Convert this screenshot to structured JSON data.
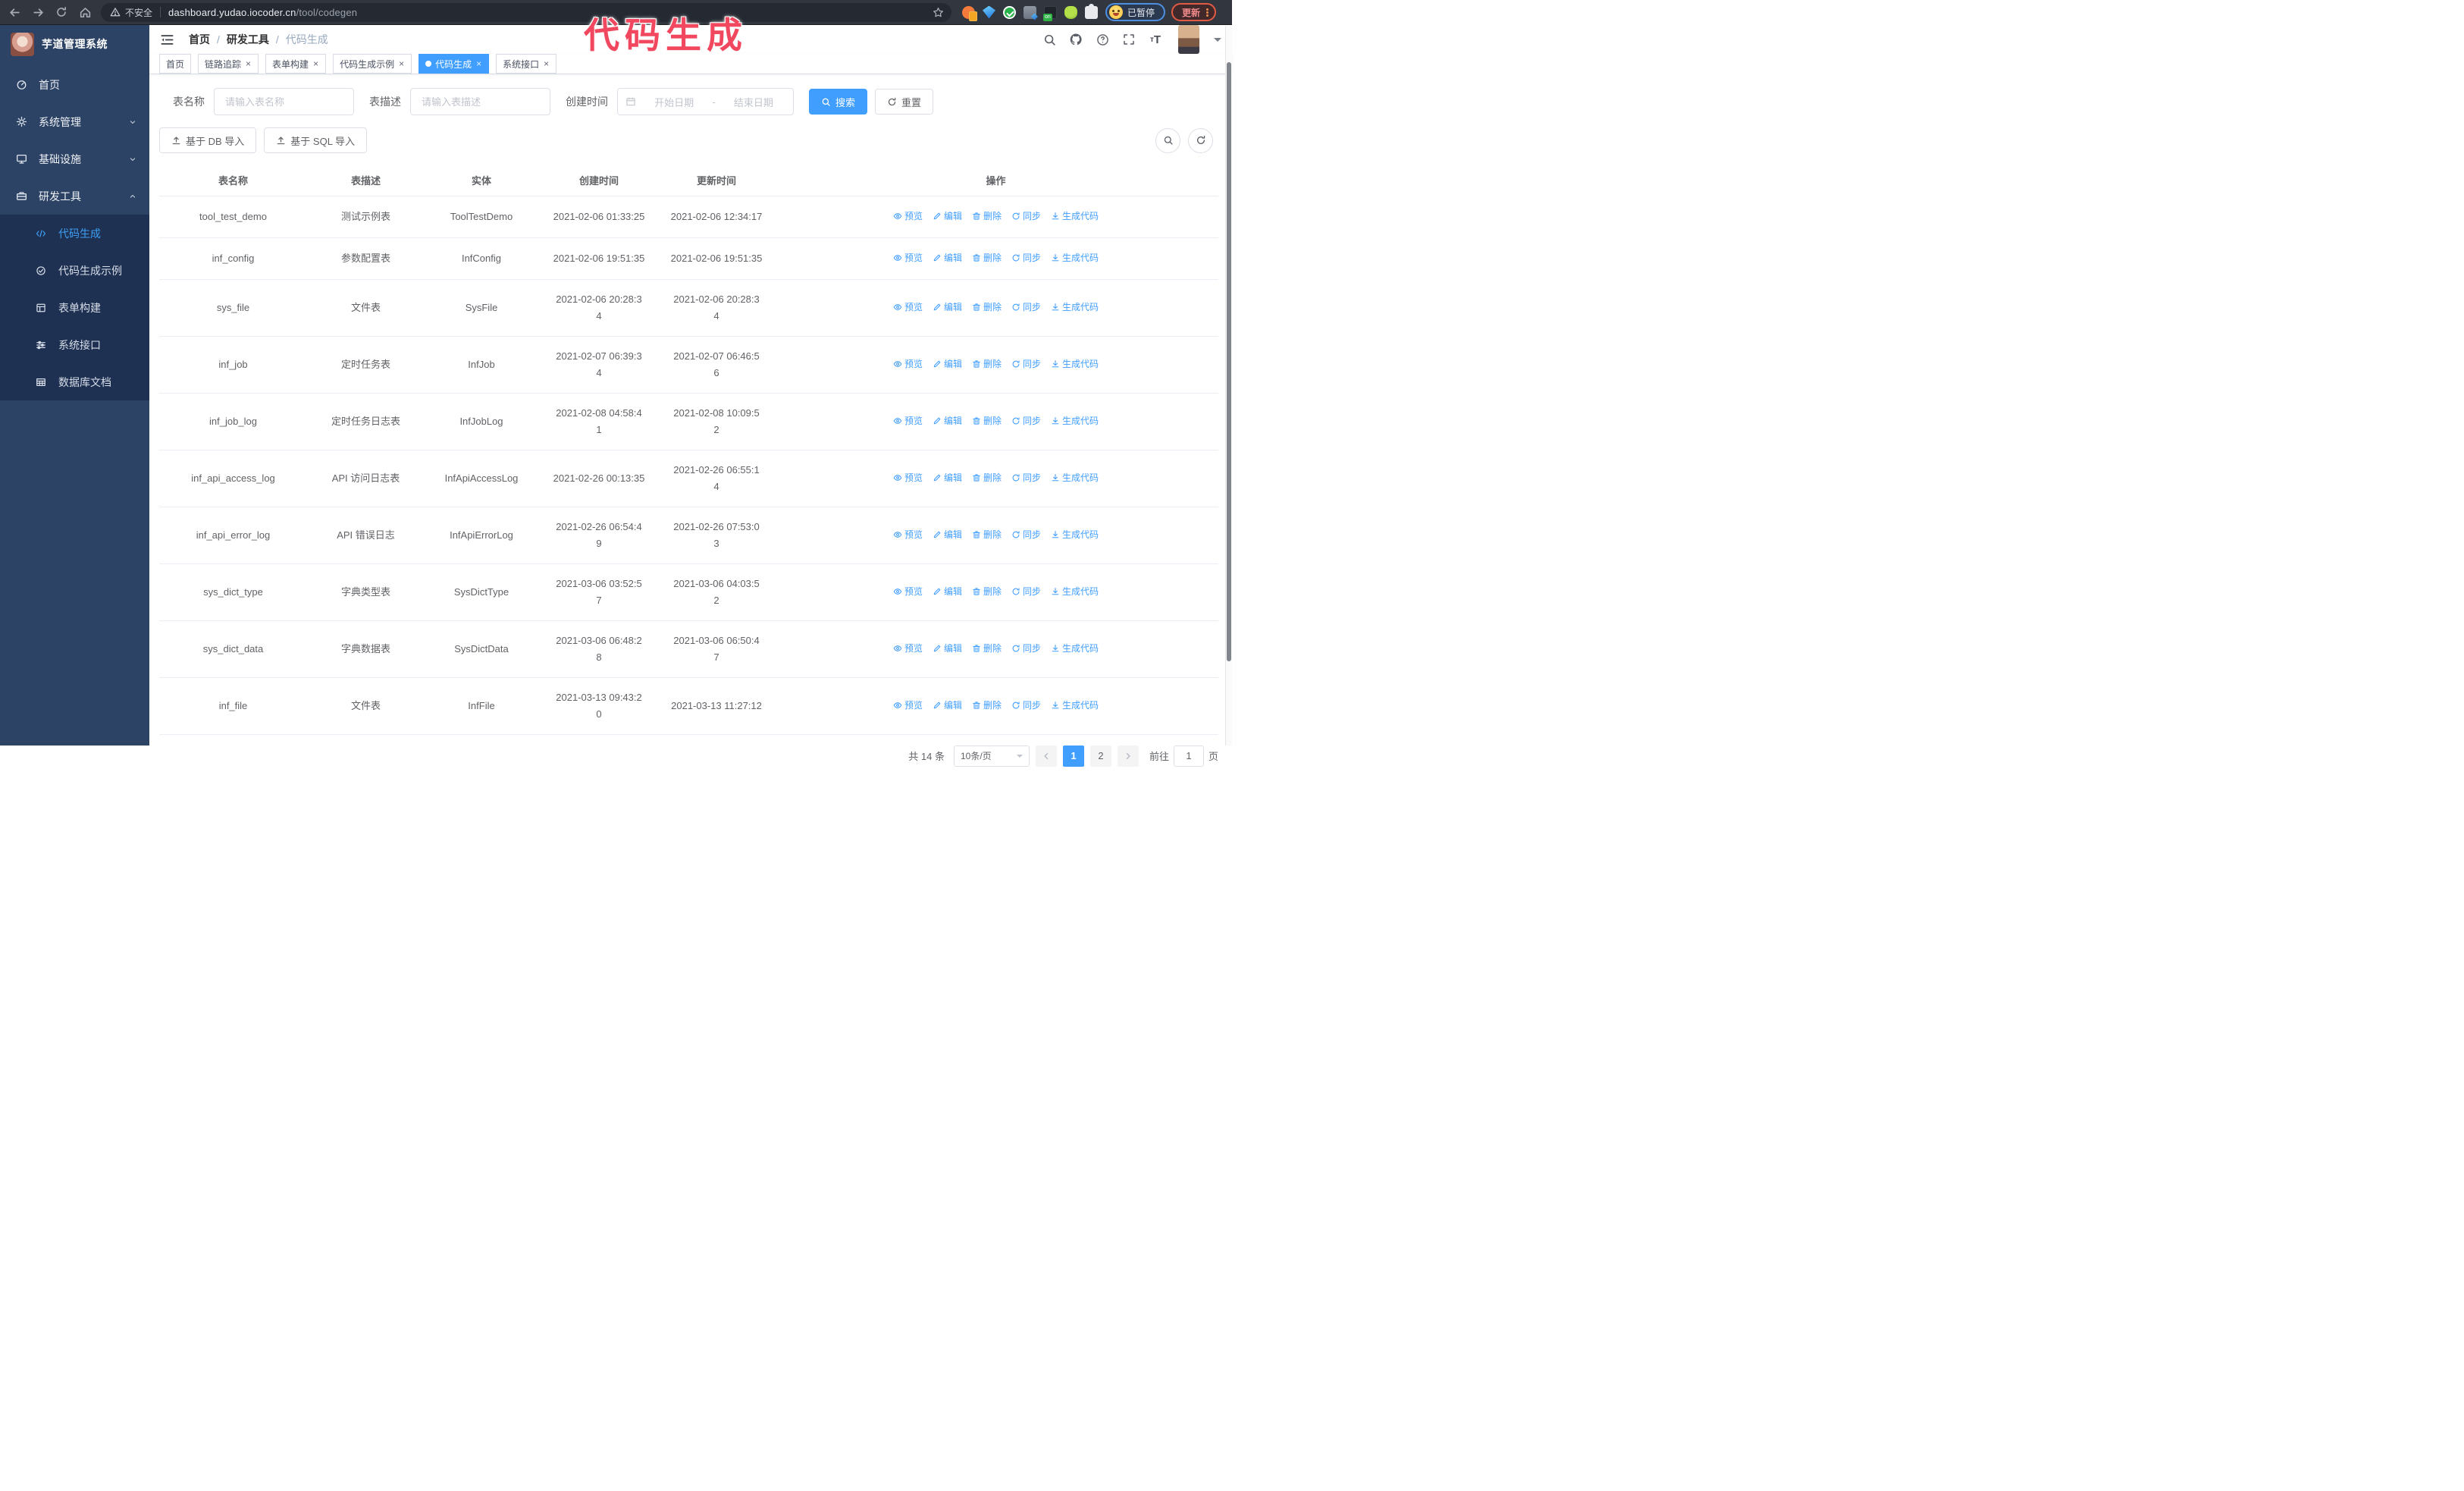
{
  "browser": {
    "insecure_label": "不安全",
    "url_host": "dashboard.yudao.iocoder.cn",
    "url_path": "/tool/codegen",
    "paused_badge": "已暂停",
    "update_button": "更新"
  },
  "annotation": {
    "text": "代码生成",
    "color": "#f2485f"
  },
  "sidebar": {
    "title": "芋道管理系统",
    "menu": [
      {
        "label": "首页",
        "icon": "dashboard",
        "chevron": ""
      },
      {
        "label": "系统管理",
        "icon": "gear",
        "chevron": "chevdown"
      },
      {
        "label": "基础设施",
        "icon": "monitor",
        "chevron": "chevdown"
      },
      {
        "label": "研发工具",
        "icon": "toolbox",
        "chevron": "chevup"
      }
    ],
    "submenu": [
      {
        "label": "代码生成",
        "icon": "code",
        "active": true
      },
      {
        "label": "代码生成示例",
        "icon": "badge"
      },
      {
        "label": "表单构建",
        "icon": "form"
      },
      {
        "label": "系统接口",
        "icon": "sliders"
      },
      {
        "label": "数据库文档",
        "icon": "dbtable"
      }
    ]
  },
  "breadcrumb": {
    "separator": "/",
    "items": [
      {
        "label": "首页"
      },
      {
        "label": "研发工具"
      },
      {
        "label": "代码生成",
        "current": true
      }
    ]
  },
  "tabs": [
    {
      "label": "首页"
    },
    {
      "label": "链路追踪",
      "closable": true
    },
    {
      "label": "表单构建",
      "closable": true
    },
    {
      "label": "代码生成示例",
      "closable": true
    },
    {
      "label": "代码生成",
      "closable": true,
      "active": true
    },
    {
      "label": "系统接口",
      "closable": true
    }
  ],
  "filters": {
    "table_name_label": "表名称",
    "table_name_placeholder": "请输入表名称",
    "table_desc_label": "表描述",
    "table_desc_placeholder": "请输入表描述",
    "create_time_label": "创建时间",
    "date_start_placeholder": "开始日期",
    "date_separator": "-",
    "date_end_placeholder": "结束日期",
    "search_button": "搜索",
    "reset_button": "重置"
  },
  "toolbar": {
    "import_db": "基于 DB 导入",
    "import_sql": "基于 SQL 导入"
  },
  "table": {
    "columns": [
      "表名称",
      "表描述",
      "实体",
      "创建时间",
      "更新时间",
      "操作"
    ],
    "actions": [
      {
        "label": "预览",
        "icon": "eye"
      },
      {
        "label": "编辑",
        "icon": "edit"
      },
      {
        "label": "删除",
        "icon": "delete"
      },
      {
        "label": "同步",
        "icon": "sync"
      },
      {
        "label": "生成代码",
        "icon": "download"
      }
    ],
    "rows": [
      {
        "name": "tool_test_demo",
        "desc": "测试示例表",
        "entity": "ToolTestDemo",
        "created": "2021-02-06 01:33:25",
        "updated": "2021-02-06 12:34:17"
      },
      {
        "name": "inf_config",
        "desc": "参数配置表",
        "entity": "InfConfig",
        "created": "2021-02-06 19:51:35",
        "updated": "2021-02-06 19:51:35"
      },
      {
        "name": "sys_file",
        "desc": "文件表",
        "entity": "SysFile",
        "created": "2021-02-06 20:28:3\n4",
        "updated": "2021-02-06 20:28:3\n4"
      },
      {
        "name": "inf_job",
        "desc": "定时任务表",
        "entity": "InfJob",
        "created": "2021-02-07 06:39:3\n4",
        "updated": "2021-02-07 06:46:5\n6"
      },
      {
        "name": "inf_job_log",
        "desc": "定时任务日志表",
        "entity": "InfJobLog",
        "created": "2021-02-08 04:58:4\n1",
        "updated": "2021-02-08 10:09:5\n2"
      },
      {
        "name": "inf_api_access_log",
        "desc": "API 访问日志表",
        "entity": "InfApiAccessLog",
        "created": "2021-02-26 00:13:35",
        "updated": "2021-02-26 06:55:1\n4"
      },
      {
        "name": "inf_api_error_log",
        "desc": "API 错误日志",
        "entity": "InfApiErrorLog",
        "created": "2021-02-26 06:54:4\n9",
        "updated": "2021-02-26 07:53:0\n3"
      },
      {
        "name": "sys_dict_type",
        "desc": "字典类型表",
        "entity": "SysDictType",
        "created": "2021-03-06 03:52:5\n7",
        "updated": "2021-03-06 04:03:5\n2"
      },
      {
        "name": "sys_dict_data",
        "desc": "字典数据表",
        "entity": "SysDictData",
        "created": "2021-03-06 06:48:2\n8",
        "updated": "2021-03-06 06:50:4\n7"
      },
      {
        "name": "inf_file",
        "desc": "文件表",
        "entity": "InfFile",
        "created": "2021-03-13 09:43:2\n0",
        "updated": "2021-03-13 11:27:12"
      }
    ]
  },
  "pagination": {
    "total": "共 14 条",
    "page_size": "10条/页",
    "pages": [
      {
        "label": "1",
        "active": true
      },
      {
        "label": "2"
      }
    ],
    "goto_label": "前往",
    "goto_value": "1",
    "goto_suffix": "页"
  },
  "colors": {
    "accent": "#409EFF",
    "sidebar_bg": "#2d4365",
    "submenu_bg": "#1f3152"
  }
}
